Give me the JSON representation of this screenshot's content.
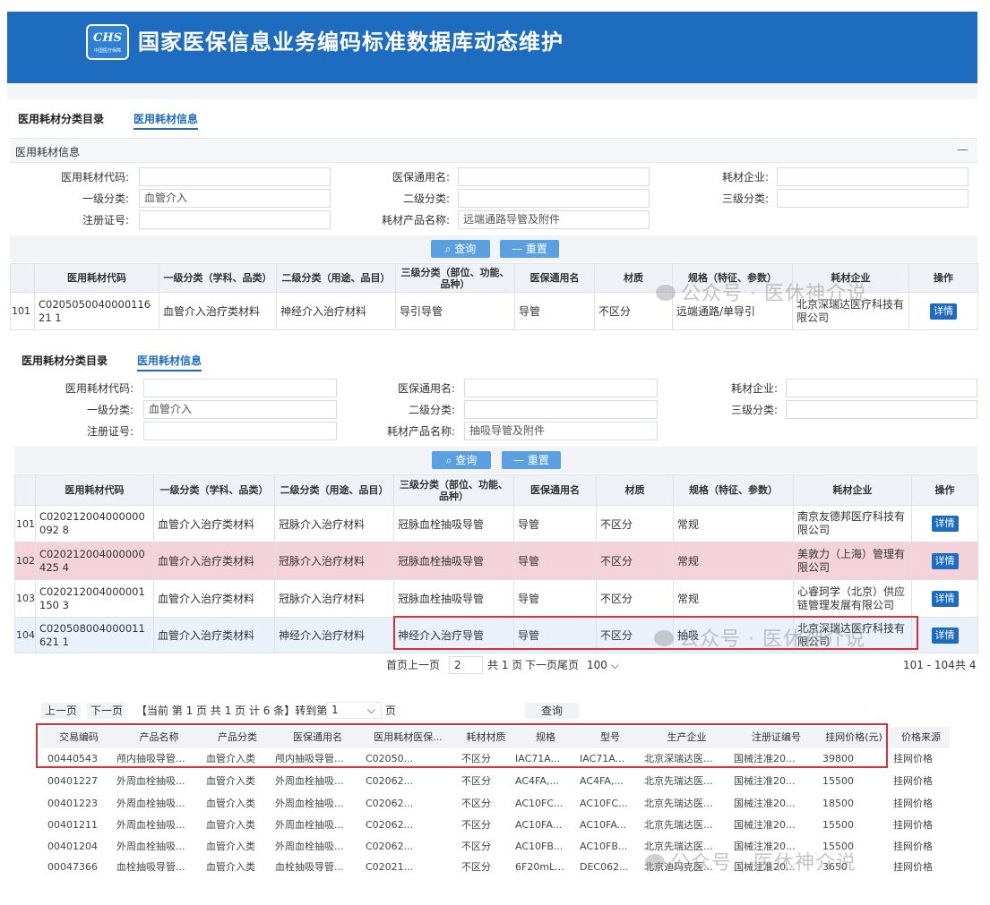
{
  "header": {
    "title": "国家医保信息业务编码标准数据库动态维护",
    "logo_top": "CHS",
    "logo_bottom": "中国医疗保障"
  },
  "tabs": {
    "catalog": "医用耗材分类目录",
    "info": "医用耗材信息"
  },
  "panel1": {
    "title": "医用耗材信息",
    "labels": {
      "code": "医用耗材代码:",
      "insurance_name": "医保通用名:",
      "company": "耗材企业:",
      "level1": "一级分类:",
      "level2": "二级分类:",
      "level3": "三级分类:",
      "reg_no": "注册证号:",
      "product_name": "耗材产品名称:"
    },
    "values": {
      "level1": "血管介入",
      "product_name": "远端通路导管及附件"
    }
  },
  "buttons": {
    "query": "查询",
    "reset": "重置"
  },
  "table_headers": [
    "医用耗材代码",
    "一级分类（学科、品类）",
    "二级分类（用途、品目）",
    "三级分类（部位、功能、品种）",
    "医保通用名",
    "材质",
    "规格（特征、参数）",
    "耗材企业",
    "操作"
  ],
  "detail_label": "详情",
  "table1": {
    "rows": [
      {
        "num": "101",
        "code": "C020505004000011621 1",
        "l1": "血管介入治疗类材料",
        "l2": "神经介入治疗材料",
        "l3": "导引导管",
        "name": "导管",
        "material": "不区分",
        "spec": "远端通路/单导引",
        "company": "北京深瑞达医疗科技有限公司"
      }
    ]
  },
  "panel2": {
    "values": {
      "level1": "血管介入",
      "product_name": "抽吸导管及附件"
    }
  },
  "table2": {
    "rows": [
      {
        "num": "101",
        "code": "C020212004000000092 8",
        "l1": "血管介入治疗类材料",
        "l2": "冠脉介入治疗材料",
        "l3": "冠脉血栓抽吸导管",
        "name": "导管",
        "material": "不区分",
        "spec": "常规",
        "company": "南京友德邦医疗科技有限公司"
      },
      {
        "num": "102",
        "code": "C020212004000000425 4",
        "l1": "血管介入治疗类材料",
        "l2": "冠脉介入治疗材料",
        "l3": "冠脉血栓抽吸导管",
        "name": "导管",
        "material": "不区分",
        "spec": "常规",
        "company": "美敦力（上海）管理有限公司"
      },
      {
        "num": "103",
        "code": "C020212004000001150 3",
        "l1": "血管介入治疗类材料",
        "l2": "冠脉介入治疗材料",
        "l3": "冠脉血栓抽吸导管",
        "name": "导管",
        "material": "不区分",
        "spec": "常规",
        "company": "心睿珂学（北京）供应链管理发展有限公司"
      },
      {
        "num": "104",
        "code": "C020508004000011621 1",
        "l1": "血管介入治疗类材料",
        "l2": "神经介入治疗材料",
        "l3": "神经介入治疗导管",
        "name": "导管",
        "material": "不区分",
        "spec": "抽吸",
        "company": "北京深瑞达医疗科技有限公司"
      }
    ]
  },
  "pager2": {
    "first_prev": "首页上一页",
    "page": "2",
    "total_pages": "共 1 页",
    "next_last": "下一页尾页",
    "page_size": "100",
    "range": "101 - 104",
    "total": "共 4"
  },
  "section3": {
    "pager": {
      "prev": "上一页",
      "next": "下一页",
      "info": "【当前 第 1 页  共 1 页  计 6 条】转到第",
      "page": "1",
      "page_unit": "页",
      "query": "查询"
    },
    "headers": [
      "交易编码",
      "产品名称",
      "产品分类",
      "医保通用名",
      "医用耗材医保...",
      "耗材材质",
      "规格",
      "型号",
      "生产企业",
      "注册证编号",
      "挂网价格(元)",
      "价格来源"
    ],
    "rows": [
      [
        "00440543",
        "颅内抽吸导管...",
        "血管介入类",
        "颅内抽吸导管...",
        "C02050...",
        "不区分",
        "IAC71A...",
        "IAC71A...",
        "北京深瑞达医...",
        "国械注准20...",
        "39800",
        "挂网价格"
      ],
      [
        "00401227",
        "外周血栓抽吸...",
        "血管介入类",
        "外周血栓抽吸...",
        "C02062...",
        "不区分",
        "AC4FA,...",
        "AC4FA,...",
        "北京先瑞达医...",
        "国械注准20...",
        "15500",
        "挂网价格"
      ],
      [
        "00401223",
        "外周血栓抽吸...",
        "血管介入类",
        "外周血栓抽吸...",
        "C02062...",
        "不区分",
        "AC10FC...",
        "AC10FC...",
        "北京先瑞达医...",
        "国械注准20...",
        "18500",
        "挂网价格"
      ],
      [
        "00401211",
        "外周血栓抽吸...",
        "血管介入类",
        "外周血栓抽吸...",
        "C02062...",
        "不区分",
        "AC10FA...",
        "AC10FA...",
        "北京先瑞达医...",
        "国械注准20...",
        "15500",
        "挂网价格"
      ],
      [
        "00401204",
        "外周血栓抽吸...",
        "血管介入类",
        "外周血栓抽吸...",
        "C02062...",
        "不区分",
        "AC10FB...",
        "AC10FB...",
        "北京先瑞达医...",
        "国械注准20...",
        "15500",
        "挂网价格"
      ],
      [
        "00047366",
        "血栓抽吸导管...",
        "血管介入类",
        "血栓抽吸导管...",
        "C02021...",
        "不区分",
        "6F20mL...",
        "DEC062...",
        "北京迪玛克医...",
        "国械注准20...",
        "3650",
        "挂网价格"
      ]
    ]
  },
  "watermark": "公众号 · 医休神介说"
}
